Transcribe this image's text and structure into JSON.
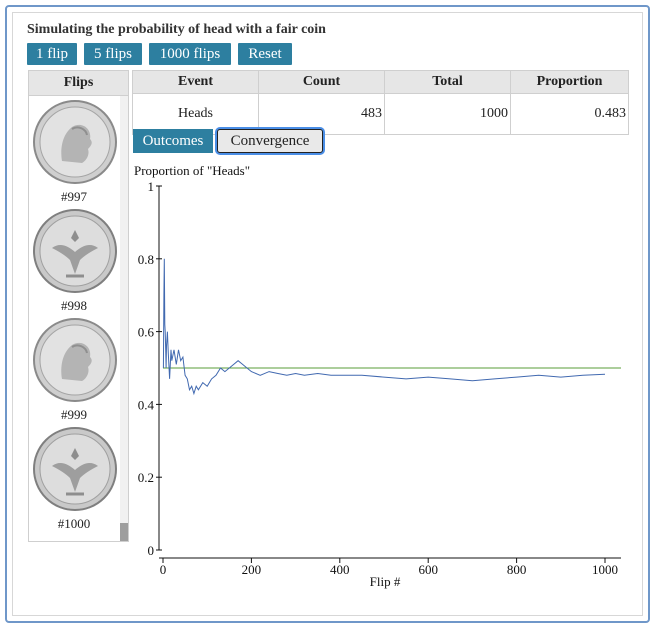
{
  "app": {
    "title": "Simulating the probability of head with a fair coin"
  },
  "toolbar": {
    "flip1": "1 flip",
    "flip5": "5 flips",
    "flip1000": "1000 flips",
    "reset": "Reset"
  },
  "flips": {
    "header": "Flips",
    "items": [
      {
        "label": "#997",
        "side": "heads"
      },
      {
        "label": "#998",
        "side": "tails"
      },
      {
        "label": "#999",
        "side": "heads"
      },
      {
        "label": "#1000",
        "side": "tails"
      }
    ]
  },
  "stats": {
    "headers": [
      "Event",
      "Count",
      "Total",
      "Proportion"
    ],
    "row": {
      "event": "Heads",
      "count": "483",
      "total": "1000",
      "proportion": "0.483"
    }
  },
  "tabs": {
    "outcomes": "Outcomes",
    "convergence": "Convergence",
    "active": "convergence"
  },
  "chart_data": {
    "type": "line",
    "ylabel": "Proportion of \"Heads\"",
    "xlabel": "Flip #",
    "xlim": [
      0,
      1000
    ],
    "ylim": [
      0,
      1
    ],
    "x_ticks": [
      "0",
      "200",
      "400",
      "600",
      "800",
      "1000"
    ],
    "y_ticks": [
      "0",
      "0.2",
      "0.4",
      "0.6",
      "0.8",
      "1"
    ],
    "reference_line": {
      "y": 0.5,
      "color": "#5a9e3a"
    },
    "series": [
      {
        "color": "#4169b0",
        "x": [
          1,
          2,
          3,
          4,
          5,
          6,
          7,
          8,
          10,
          12,
          15,
          18,
          20,
          25,
          30,
          35,
          40,
          45,
          50,
          55,
          60,
          65,
          70,
          75,
          80,
          90,
          100,
          110,
          120,
          130,
          140,
          150,
          160,
          170,
          180,
          190,
          200,
          220,
          240,
          260,
          280,
          300,
          320,
          350,
          380,
          400,
          450,
          500,
          550,
          600,
          650,
          700,
          750,
          800,
          850,
          900,
          950,
          1000
        ],
        "values": [
          0.5,
          0.7,
          0.8,
          0.62,
          0.6,
          0.55,
          0.5,
          0.56,
          0.6,
          0.54,
          0.47,
          0.55,
          0.52,
          0.55,
          0.51,
          0.55,
          0.52,
          0.53,
          0.48,
          0.47,
          0.44,
          0.45,
          0.43,
          0.45,
          0.44,
          0.46,
          0.45,
          0.47,
          0.48,
          0.5,
          0.49,
          0.5,
          0.51,
          0.52,
          0.51,
          0.5,
          0.49,
          0.48,
          0.49,
          0.485,
          0.48,
          0.485,
          0.48,
          0.485,
          0.48,
          0.48,
          0.48,
          0.475,
          0.47,
          0.475,
          0.47,
          0.465,
          0.47,
          0.475,
          0.48,
          0.475,
          0.48,
          0.483
        ]
      }
    ]
  }
}
